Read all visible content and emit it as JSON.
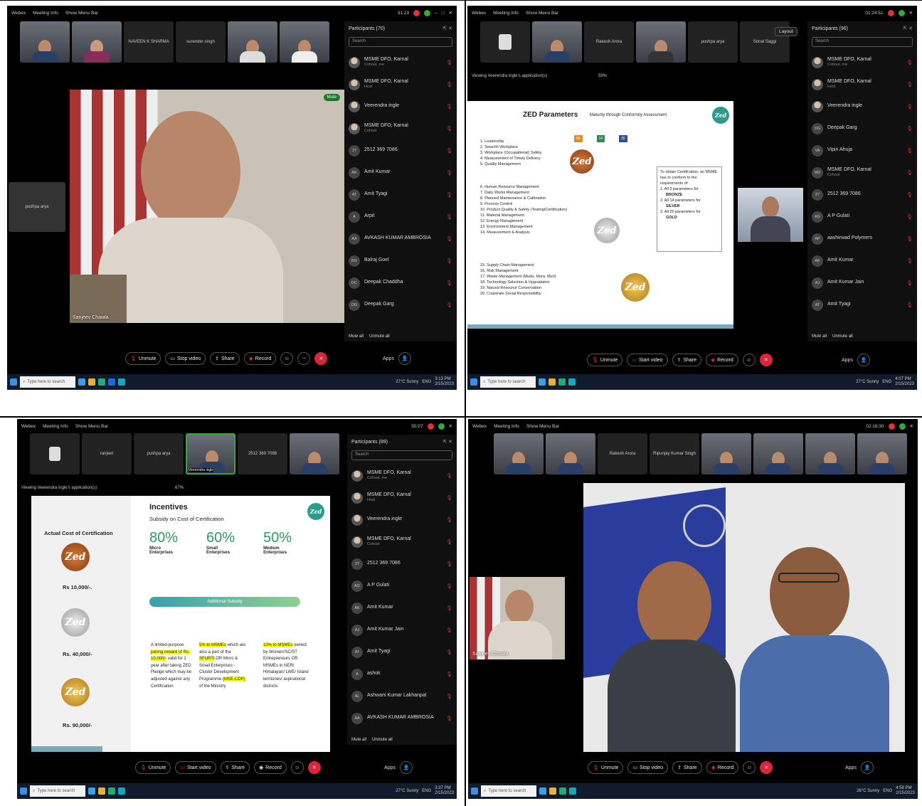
{
  "common": {
    "app_name": "Webex",
    "meeting_info": "Meeting Info",
    "show_menu_bar": "Show Menu Bar",
    "search_placeholder": "Search",
    "mute_all": "Mute all",
    "unmute_all": "Unmute all",
    "unmute": "Unmute",
    "stop_video": "Stop video",
    "start_video": "Start video",
    "share": "Share",
    "record": "Record",
    "apps": "Apps",
    "taskbar_search": "Type here to search",
    "date": "2/15/2023",
    "lang": "ENG"
  },
  "q1": {
    "timer": "31:23",
    "participants_title": "Participants (70)",
    "strip": [
      "NAVEEN K SHARMA",
      "surender singh"
    ],
    "side_tile": "pushpa arya",
    "speaker": "Sanjeev Chawla",
    "mute_label": "Mute",
    "participants": [
      {
        "name": "MSME DFO, Karnal",
        "sub": "Cohost, me",
        "av": ""
      },
      {
        "name": "MSME DFO, Karnal",
        "sub": "Host",
        "av": ""
      },
      {
        "name": "Veerendra ingle",
        "sub": "",
        "av": ""
      },
      {
        "name": "MSME DFO, Karnal",
        "sub": "Cohost",
        "av": ""
      },
      {
        "name": "2512 369 7086",
        "sub": "",
        "av": "27"
      },
      {
        "name": "Amit Kumar",
        "sub": "",
        "av": "AK"
      },
      {
        "name": "Amit Tyagi",
        "sub": "",
        "av": "AT"
      },
      {
        "name": "Arpit",
        "sub": "",
        "av": "A"
      },
      {
        "name": "AVKASH KUMAR AMBROSIA",
        "sub": "",
        "av": "AA"
      },
      {
        "name": "Balraj Goel",
        "sub": "",
        "av": "BG"
      },
      {
        "name": "Deepak Chaddha",
        "sub": "",
        "av": "DC"
      },
      {
        "name": "Deepak Garg",
        "sub": "",
        "av": "DG"
      }
    ],
    "weather": "27°C Sunny",
    "clock": "3:13 PM"
  },
  "q2": {
    "timer": "01:24:51",
    "participants_title": "Participants (96)",
    "layout_btn": "Layout",
    "strip": [
      "Rakesh Arora",
      "pushpa arya",
      "Sonal Saggi"
    ],
    "viewing": "Viewing Veerendra ingle's application(s)",
    "zoom": "59%",
    "slide": {
      "title": "ZED Parameters",
      "subtitle": "Maturity through Conformity Assessment",
      "counts": [
        "05",
        "14",
        "20"
      ],
      "params_a": [
        "1. Leadership",
        "2. Swachh Workplace",
        "3. Workplace (Occupational) Safety",
        "4. Measurement of Timely Delivery",
        "5. Quality Management"
      ],
      "params_b": [
        "6. Human Resource Management",
        "7. Daily Works Management",
        "8. Planned Maintenance & Calibration",
        "9. Process Control",
        "10. Product Quality & Safety (Testing/Certification)",
        "11. Material Management",
        "12. Energy Management",
        "13. Environment Management",
        "14. Measurement & Analysis"
      ],
      "params_c": [
        "15. Supply Chain Management",
        "16. Risk Management",
        "17. Waste Management (Muda, Mura, Muri)",
        "18. Technology Selection & Upgradation",
        "19. Natural Resource Conservation",
        "20. Corporate Social Responsibility"
      ],
      "box_intro": "To obtain Certification, an MSME has to conform to the requirements of:",
      "box_items": [
        "1. All 5 parameters for",
        "BRONZE",
        "2. All 14 parameters for",
        "SILVER",
        "3. All 20 parameters for",
        "GOLD"
      ],
      "zed": "Zed"
    },
    "participants": [
      {
        "name": "MSME DFO, Karnal",
        "sub": "Cohost, me",
        "av": ""
      },
      {
        "name": "MSME DFO, Karnal",
        "sub": "Host",
        "av": ""
      },
      {
        "name": "Veerendra ingle",
        "sub": "",
        "av": ""
      },
      {
        "name": "Deepak Garg",
        "sub": "",
        "av": "DG"
      },
      {
        "name": "Vipin Ahuja",
        "sub": "",
        "av": "VA"
      },
      {
        "name": "MSME DFO, Karnal",
        "sub": "Cohost",
        "av": "MD"
      },
      {
        "name": "2512 369 7086",
        "sub": "",
        "av": "27"
      },
      {
        "name": "A P Gulati",
        "sub": "",
        "av": "AG"
      },
      {
        "name": "aashirwad Polymers",
        "sub": "",
        "av": "AP"
      },
      {
        "name": "Amit Kumar",
        "sub": "",
        "av": "AK"
      },
      {
        "name": "Amit Kumar Jain",
        "sub": "",
        "av": "AJ"
      },
      {
        "name": "Amit Tyagi",
        "sub": "",
        "av": "AT"
      }
    ],
    "weather": "27°C Sunny",
    "clock": "4:07 PM"
  },
  "q3": {
    "timer": "55:07",
    "participants_title": "Participants (89)",
    "strip": [
      "ranjeet",
      "pushpa arya",
      "Veerendra ingle",
      "2512 369 7086"
    ],
    "viewing": "Viewing Veerendra ingle's application(s)",
    "zoom": "67%",
    "slide": {
      "left_title": "Actual Cost of Certification",
      "costs": [
        "Rs 10,000/-.",
        "Rs. 40,000/-",
        "Rs. 90,000/-"
      ],
      "title": "Incentives",
      "subtitle": "Subsidy on Cost of Certification",
      "pcts": [
        "80%",
        "60%",
        "50%"
      ],
      "cats": [
        "Micro Enterprises",
        "Small Enterprises",
        "Medium Enterprises"
      ],
      "bar": "Additional Subsidy",
      "col1": [
        "A limited-purpose",
        "joining reward of",
        "Rs. 10,000/-",
        "valid for 1 year after taking ZED Pledge which may be adjusted against any Certification"
      ],
      "col2": [
        "5% to MSMEs",
        "which are also a part of the",
        "SFURTI",
        "OR Micro & Small Enterprises - Cluster Development Programme",
        "(MSE-CDP)",
        "of the Ministry"
      ],
      "col3": [
        "10% to MSMEs",
        "owned by Women/SC/ST Entrepreneurs OR MSMEs in NER/ Himalayan/ LWE/ Island territories/ aspirational districts"
      ],
      "zed": "Zed"
    },
    "participants": [
      {
        "name": "MSME DFO, Karnal",
        "sub": "Cohost, me",
        "av": ""
      },
      {
        "name": "MSME DFO, Karnal",
        "sub": "Host",
        "av": ""
      },
      {
        "name": "Veerendra ingle",
        "sub": "",
        "av": ""
      },
      {
        "name": "MSME DFO, Karnal",
        "sub": "Cohost",
        "av": ""
      },
      {
        "name": "2512 369 7086",
        "sub": "",
        "av": "27"
      },
      {
        "name": "A P Gulati",
        "sub": "",
        "av": "AG"
      },
      {
        "name": "Amit Kumar",
        "sub": "",
        "av": "AK"
      },
      {
        "name": "Amit Kumar Jain",
        "sub": "",
        "av": "AJ"
      },
      {
        "name": "Amit Tyagi",
        "sub": "",
        "av": "AT"
      },
      {
        "name": "ashok",
        "sub": "",
        "av": "A"
      },
      {
        "name": "Ashwani Kumar Lakhanpal",
        "sub": "",
        "av": "AL"
      },
      {
        "name": "AVKASH KUMAR AMBROSIA",
        "sub": "",
        "av": "AA"
      }
    ],
    "weather": "27°C Sunny",
    "clock": "3:37 PM"
  },
  "q4": {
    "timer": "02:16:30",
    "strip": [
      "Rakesh Arora",
      "Ripunjay Kumar Singh"
    ],
    "side_speaker": "Sanjeev Chawla",
    "weather": "26°C Sunny",
    "clock": "4:58 PM"
  }
}
